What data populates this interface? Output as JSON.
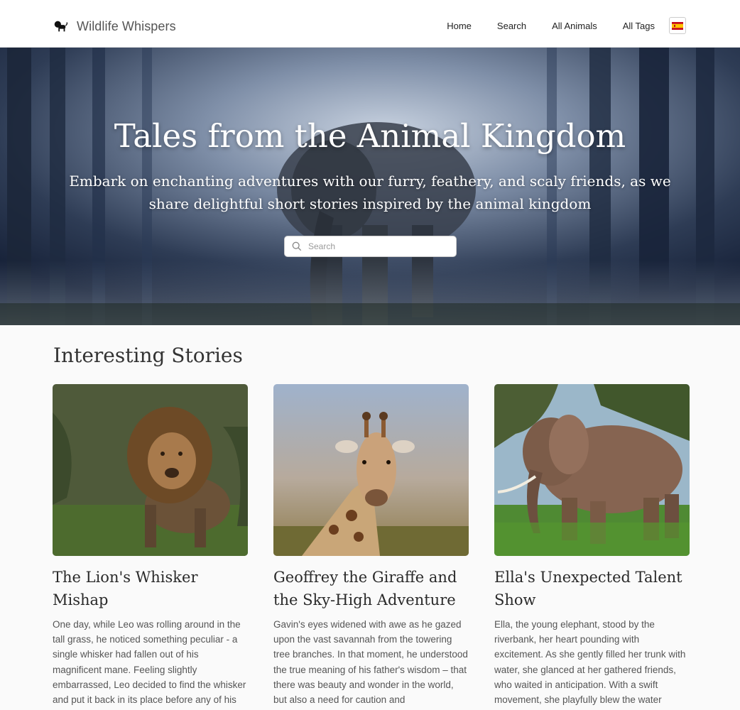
{
  "nav": {
    "brand": "Wildlife Whispers",
    "brand_icon": "lion-icon",
    "links": [
      "Home",
      "Search",
      "All Animals",
      "All Tags"
    ],
    "language_icon": "spain-flag-icon"
  },
  "hero": {
    "title": "Tales from the Animal Kingdom",
    "subtitle": "Embark on enchanting adventures with our furry, feathery, and scaly friends, as we share delightful short stories inspired by the animal kingdom",
    "search_placeholder": "Search"
  },
  "stories": {
    "heading": "Interesting Stories",
    "cards": [
      {
        "title": "The Lion's Whisker Mishap",
        "text": "One day, while Leo was rolling around in the tall grass, he noticed something peculiar - a single whisker had fallen out of his magnificent mane. Feeling slightly embarrassed, Leo decided to find the whisker and put it back in its place before any of his friends noticed. Just as he was about to give up, he heard a soft giggle."
      },
      {
        "title": "Geoffrey the Giraffe and the Sky-High Adventure",
        "text": "Gavin's eyes widened with awe as he gazed upon the vast savannah from the towering tree branches. In that moment, he understood the true meaning of his father's wisdom – that there was beauty and wonder in the world, but also a need for caution and"
      },
      {
        "title": "Ella's Unexpected Talent Show",
        "text": "Ella, the young elephant, stood by the riverbank, her heart pounding with excitement. As she gently filled her trunk with water, she glanced at her gathered friends, who waited in anticipation. With a swift movement, she playfully blew the water through her trunk, producing a captivating"
      }
    ]
  }
}
